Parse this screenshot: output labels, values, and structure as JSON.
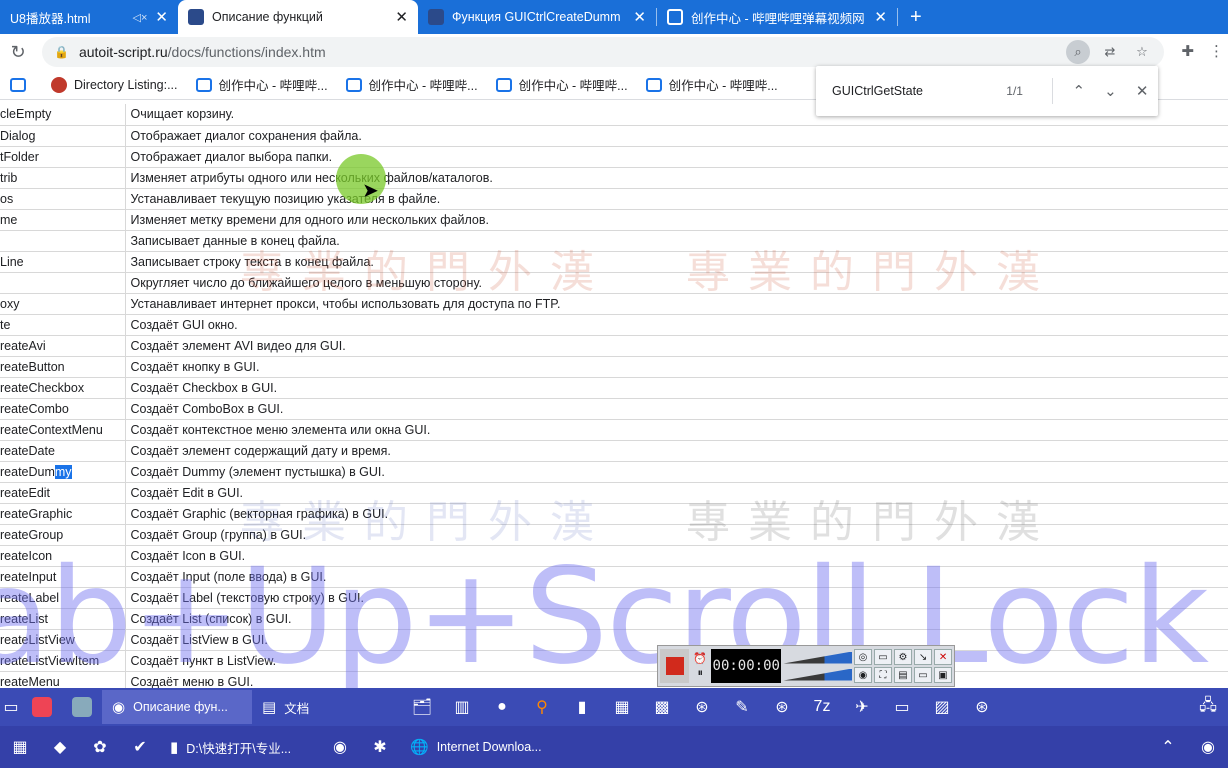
{
  "colors": {
    "tabstrip": "#1a6fd8",
    "highlight": "#1a73e8",
    "taskbar": "#3b4bb5"
  },
  "tabs": [
    {
      "label": "U8播放器.html",
      "icon": "page-icon"
    },
    {
      "label": "Описание функций",
      "icon": "autoit-icon",
      "active": true
    },
    {
      "label": "Функция GUICtrlCreateDumm",
      "icon": "autoit-icon"
    },
    {
      "label": "创作中心 - 哔哩哔哩弹幕视频网",
      "icon": "bilibili-icon"
    }
  ],
  "address": {
    "host": "autoit-script.ru",
    "path": "/docs/functions/index.htm"
  },
  "bookmarks": [
    "Directory Listing:...",
    "创作中心 - 哔哩哔...",
    "创作中心 - 哔哩哔...",
    "创作中心 - 哔哩哔...",
    "创作中心 - 哔哩哔..."
  ],
  "find": {
    "query": "GUICtrlGetState",
    "count": "1/1"
  },
  "rows": [
    {
      "fn": "cleEmpty",
      "desc": "Очищает корзину."
    },
    {
      "fn": "Dialog",
      "desc": "Отображает диалог сохранения файла."
    },
    {
      "fn": "tFolder",
      "desc": "Отображает диалог выбора папки."
    },
    {
      "fn": "trib",
      "desc": "Изменяет атрибуты одного или нескольких файлов/каталогов."
    },
    {
      "fn": "os",
      "desc": "Устанавливает текущую позицию указателя в файле."
    },
    {
      "fn": "me",
      "desc": "Изменяет метку времени для одного или нескольких файлов."
    },
    {
      "fn": "",
      "desc": "Записывает данные в конец файла."
    },
    {
      "fn": "Line",
      "desc": "Записывает строку текста в конец файла."
    },
    {
      "fn": "",
      "desc": "Округляет число до ближайшего целого в меньшую сторону."
    },
    {
      "fn": "oxy",
      "desc": "Устанавливает интернет прокси, чтобы использовать для доступа по FTP."
    },
    {
      "fn": "te",
      "desc": "Создаёт GUI окно."
    },
    {
      "fn": "reateAvi",
      "desc": "Создаёт элемент AVI видео для GUI."
    },
    {
      "fn": "reateButton",
      "desc": "Создаёт кнопку в GUI."
    },
    {
      "fn": "reateCheckbox",
      "desc": "Создаёт Checkbox в GUI."
    },
    {
      "fn": "reateCombo",
      "desc": "Создаёт ComboBox в GUI."
    },
    {
      "fn": "reateContextMenu",
      "desc": "Создаёт контекстное меню элемента или окна GUI."
    },
    {
      "fn": "reateDate",
      "desc": "Создаёт элемент содержащий дату и время."
    },
    {
      "fn": "reateDum",
      "fn_hl": "my",
      "desc": "Создаёт Dummy (элемент пустышка) в GUI."
    },
    {
      "fn": "reateEdit",
      "desc": "Создаёт Edit в GUI."
    },
    {
      "fn": "reateGraphic",
      "desc": "Создаёт Graphic (векторная графика) в GUI."
    },
    {
      "fn": "reateGroup",
      "desc": "Создаёт Group (группа) в GUI."
    },
    {
      "fn": "reateIcon",
      "desc": "Создаёт Icon в GUI."
    },
    {
      "fn": "reateInput",
      "desc": "Создаёт Input (поле ввода) в GUI."
    },
    {
      "fn": "reateLabel",
      "desc": "Создаёт Label (текстовую строку) в GUI."
    },
    {
      "fn": "reateList",
      "desc": "Создаёт List (список) в GUI."
    },
    {
      "fn": "reateListView",
      "desc": "Создаёт ListView в GUI."
    },
    {
      "fn": "reateListViewItem",
      "desc": "Создаёт пункт в ListView."
    },
    {
      "fn": "reateMenu",
      "desc": "Создаёт меню в GUI."
    }
  ],
  "overlay_text": "ab+Up+Scroll Lock",
  "watermark_text": "專業的門外漢",
  "recorder": {
    "timer": "00:00:00"
  },
  "taskbar1": {
    "chrome_label": "Описание фун...",
    "doc_label": "文档"
  },
  "taskbar2": {
    "folder_label": "D:\\快速打开\\专业...",
    "idm_label": "Internet Downloa..."
  }
}
